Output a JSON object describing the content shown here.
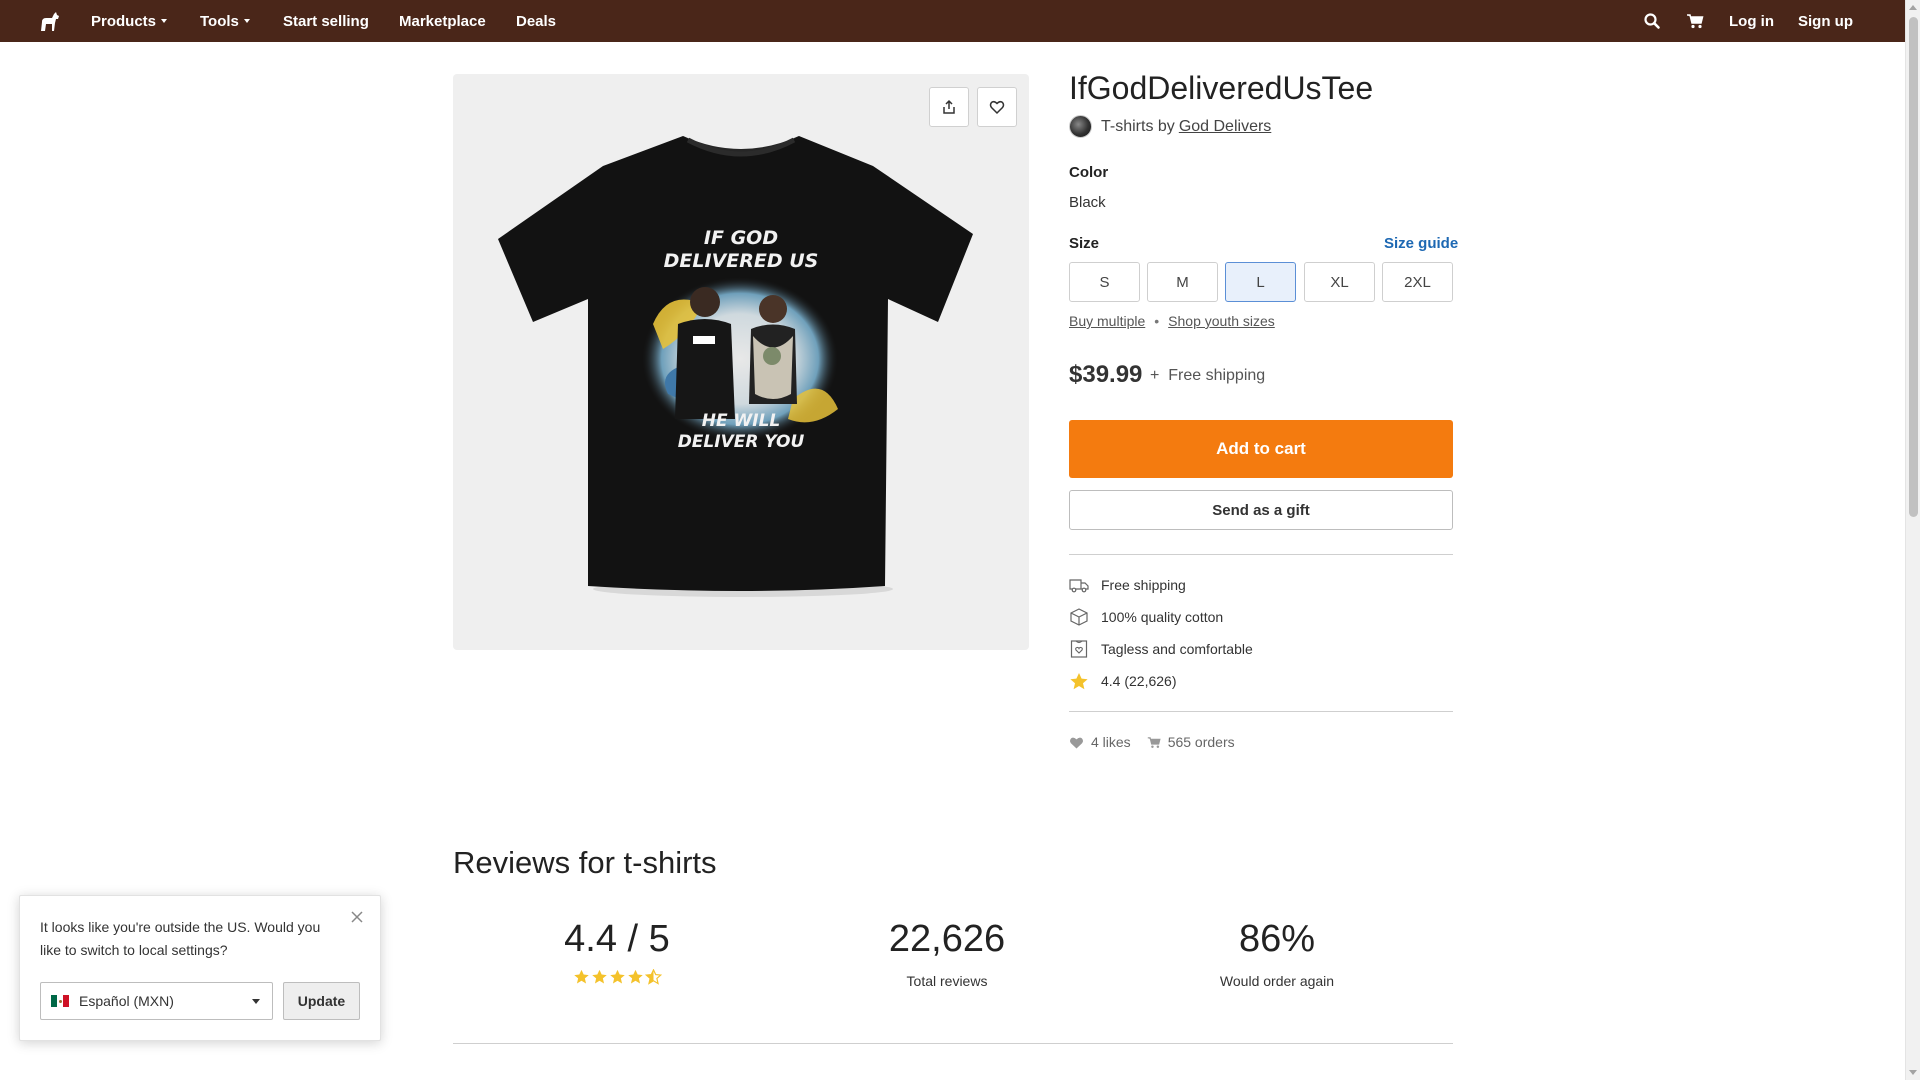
{
  "nav": {
    "items": [
      {
        "label": "Products",
        "dropdown": true
      },
      {
        "label": "Tools",
        "dropdown": true
      },
      {
        "label": "Start selling"
      },
      {
        "label": "Marketplace"
      },
      {
        "label": "Deals"
      }
    ],
    "login": "Log in",
    "signup": "Sign up",
    "icons": [
      "horse-logo-icon",
      "search-icon",
      "cart-icon"
    ],
    "bg_color": "#4a2619"
  },
  "product": {
    "title": "IfGodDeliveredUsTee",
    "category": "T-shirts",
    "by": "by",
    "artist": "God Delivers",
    "shirt_text_top": "IF GOD DELIVERED US",
    "shirt_text_bottom": "HE WILL DELIVER YOU",
    "color_label": "Color",
    "color_value": "Black",
    "size_label": "Size",
    "size_guide": "Size guide",
    "sizes": [
      "S",
      "M",
      "L",
      "XL",
      "2XL"
    ],
    "selected_size": "L",
    "buy_multiple": "Buy multiple",
    "youth_sizes": "Shop youth sizes",
    "price": "$39.99",
    "plus": "+",
    "shipping": "Free shipping",
    "add_to_cart": "Add to cart",
    "send_gift": "Send as a gift",
    "accent_color": "#f47b0f",
    "features": [
      {
        "icon": "truck-icon",
        "text": "Free shipping"
      },
      {
        "icon": "box-icon",
        "text": "100% quality cotton"
      },
      {
        "icon": "tag-icon",
        "text": "Tagless and comfortable"
      },
      {
        "icon": "star-icon",
        "text": "4.4 (22,626)"
      }
    ],
    "likes": "4 likes",
    "orders": "565 orders"
  },
  "reviews": {
    "title": "Reviews for t-shirts",
    "rating": "4.4 / 5",
    "stars": 4.5,
    "total": "22,626",
    "total_label": "Total reviews",
    "again": "86%",
    "again_label": "Would order again"
  },
  "popup": {
    "text": "It looks like you're outside the US. Would you like to switch to local settings?",
    "locale": "Español (MXN)",
    "update": "Update"
  }
}
